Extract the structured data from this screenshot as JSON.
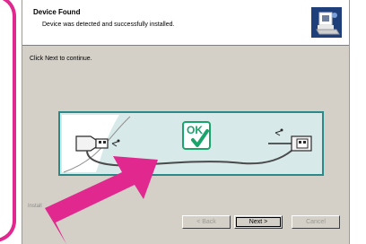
{
  "header": {
    "title": "Device Found",
    "subtitle": "Device was detected and successfully installed.",
    "icon": "installer-computer-icon"
  },
  "main": {
    "instruction": "Click Next to continue.",
    "illustration": {
      "badge_text": "OK",
      "icons": [
        "usb-plug-icon",
        "ok-check-icon",
        "usb-cable-icon"
      ]
    }
  },
  "status": {
    "text": "Install"
  },
  "buttons": {
    "back_label": "< Back",
    "next_label": "Next >",
    "cancel_label": "Cancel"
  },
  "colors": {
    "annotation_accent": "#e0288f",
    "illustration_frame": "#2a8a89",
    "illustration_bg": "#d7e9e9",
    "ok_green": "#1aa36b"
  }
}
